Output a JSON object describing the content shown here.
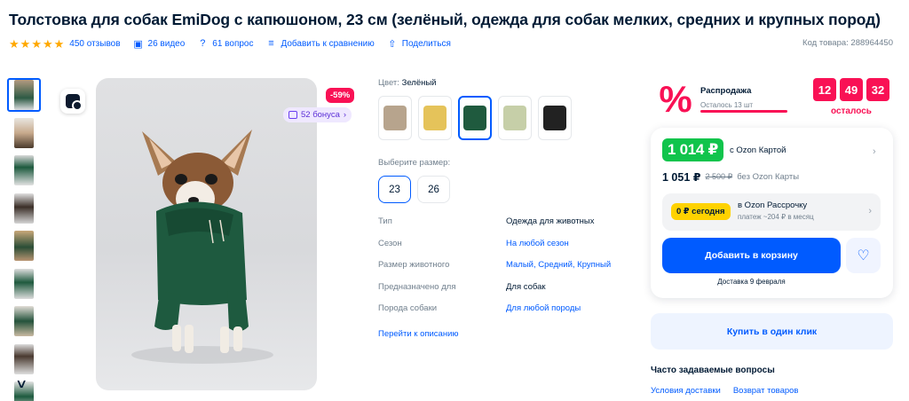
{
  "title": "Толстовка для собак EmiDog с капюшоном, 23 см (зелёный, одежда для собак мелких, средних и крупных пород)",
  "meta": {
    "rating_stars": 5,
    "reviews": "450 отзывов",
    "videos": "26 видео",
    "questions": "61 вопрос",
    "compare": "Добавить к сравнению",
    "share": "Поделиться",
    "product_code": "Код товара: 288964450"
  },
  "gallery": {
    "discount": "-59%",
    "bonus": "52 бонуса"
  },
  "color": {
    "label": "Цвет:",
    "value": "Зелёный",
    "swatches": [
      {
        "name": "Бежевый",
        "color": "#b7a48d"
      },
      {
        "name": "Жёлтый",
        "color": "#e5c35a"
      },
      {
        "name": "Зелёный",
        "color": "#1f5a3e"
      },
      {
        "name": "Оливковый",
        "color": "#c6cfa8"
      },
      {
        "name": "Чёрный",
        "color": "#222222"
      }
    ]
  },
  "size": {
    "label": "Выберите размер:",
    "options": [
      "23",
      "26"
    ]
  },
  "props": [
    {
      "k": "Тип",
      "v": "Одежда для животных"
    },
    {
      "k": "Сезон",
      "v": "На любой сезон"
    },
    {
      "k": "Размер животного",
      "v": "Малый, Средний, Крупный"
    },
    {
      "k": "Предназначено для",
      "v": "Для собак"
    },
    {
      "k": "Порода собаки",
      "v": "Для любой породы"
    }
  ],
  "to_description": "Перейти к описанию",
  "sale": {
    "title": "Распродажа",
    "left": "Осталось 13 шт",
    "timer": [
      "12",
      "49",
      "32"
    ],
    "timer_label": "осталось"
  },
  "price": {
    "card_price": "1 014 ₽",
    "card_label": "с Ozon Картой",
    "price": "1 051 ₽",
    "old_price": "2 500 ₽",
    "without_card": "без Ozon Карты"
  },
  "installment": {
    "pill": "0 ₽ сегодня",
    "title": "в Ozon Рассрочку",
    "subtitle": "платеж ~204 ₽ в месяц"
  },
  "cart_button": "Добавить в корзину",
  "delivery": "Доставка 9 февраля",
  "one_click": "Купить в один клик",
  "faq": {
    "title": "Часто задаваемые вопросы",
    "links": [
      "Условия доставки",
      "Возврат товаров"
    ]
  },
  "colors": {
    "accent": "#005bff",
    "sale": "#f91155",
    "green_price": "#10c44c",
    "star": "#ffa800"
  }
}
